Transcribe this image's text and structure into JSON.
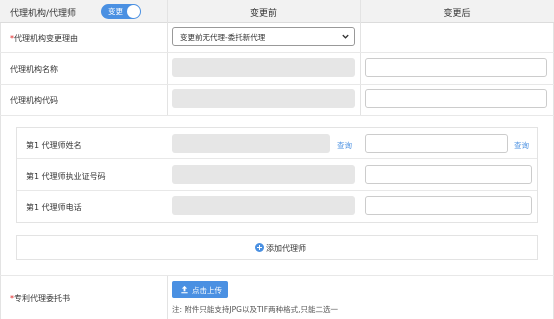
{
  "header": {
    "title": "代理机构/代理师",
    "toggle_label": "变更",
    "col_before": "变更前",
    "col_after": "变更后"
  },
  "form": {
    "reason": {
      "required_mark": "*",
      "label": "代理机构变更理由",
      "select_value": "变更前无代理-委托新代理"
    },
    "agency_name": {
      "label": "代理机构名称"
    },
    "agency_code": {
      "label": "代理机构代码"
    },
    "agent": {
      "name_label": "第1 代理师姓名",
      "license_label": "第1 代理师执业证号码",
      "phone_label": "第1 代理师电话",
      "query_before": "查询",
      "query_after": "查询"
    },
    "add_agent_label": "添加代理师",
    "power_of_attorney": {
      "required_mark": "*",
      "label": "专利代理委托书",
      "upload_label": "点击上传",
      "note": "注: 附件只能支持JPG以及TIF两种格式,只能二选一"
    }
  },
  "colors": {
    "accent": "#4a90e2",
    "required": "#e02020",
    "disabled_field": "#e6e6e6"
  },
  "icons": [
    "chevron-down-icon",
    "plus-circle-icon",
    "upload-icon"
  ]
}
